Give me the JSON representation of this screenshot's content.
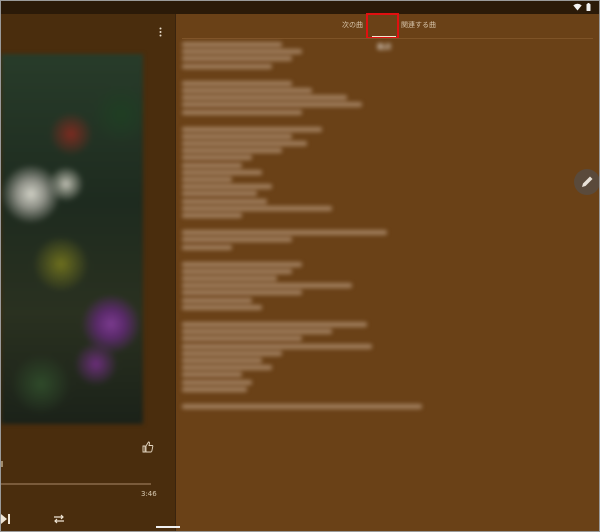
{
  "statusbar": {
    "icons": [
      "wifi-icon",
      "battery-icon"
    ]
  },
  "player": {
    "menu_icon": "more-vert-icon",
    "duration": "3:46",
    "like_icon": "thumb-up-icon",
    "next_icon": "skip-next-icon",
    "repeat_icon": "repeat-icon"
  },
  "tabs": {
    "next": "次の曲",
    "lyrics": "歌詞",
    "related": "関連する曲",
    "selected": "lyrics"
  },
  "accent": {
    "highlight_color": "#e01010",
    "panel_color": "#6a4117",
    "player_color": "#4a2d0d"
  },
  "fab": {
    "icon": "edit-pencil-icon"
  }
}
